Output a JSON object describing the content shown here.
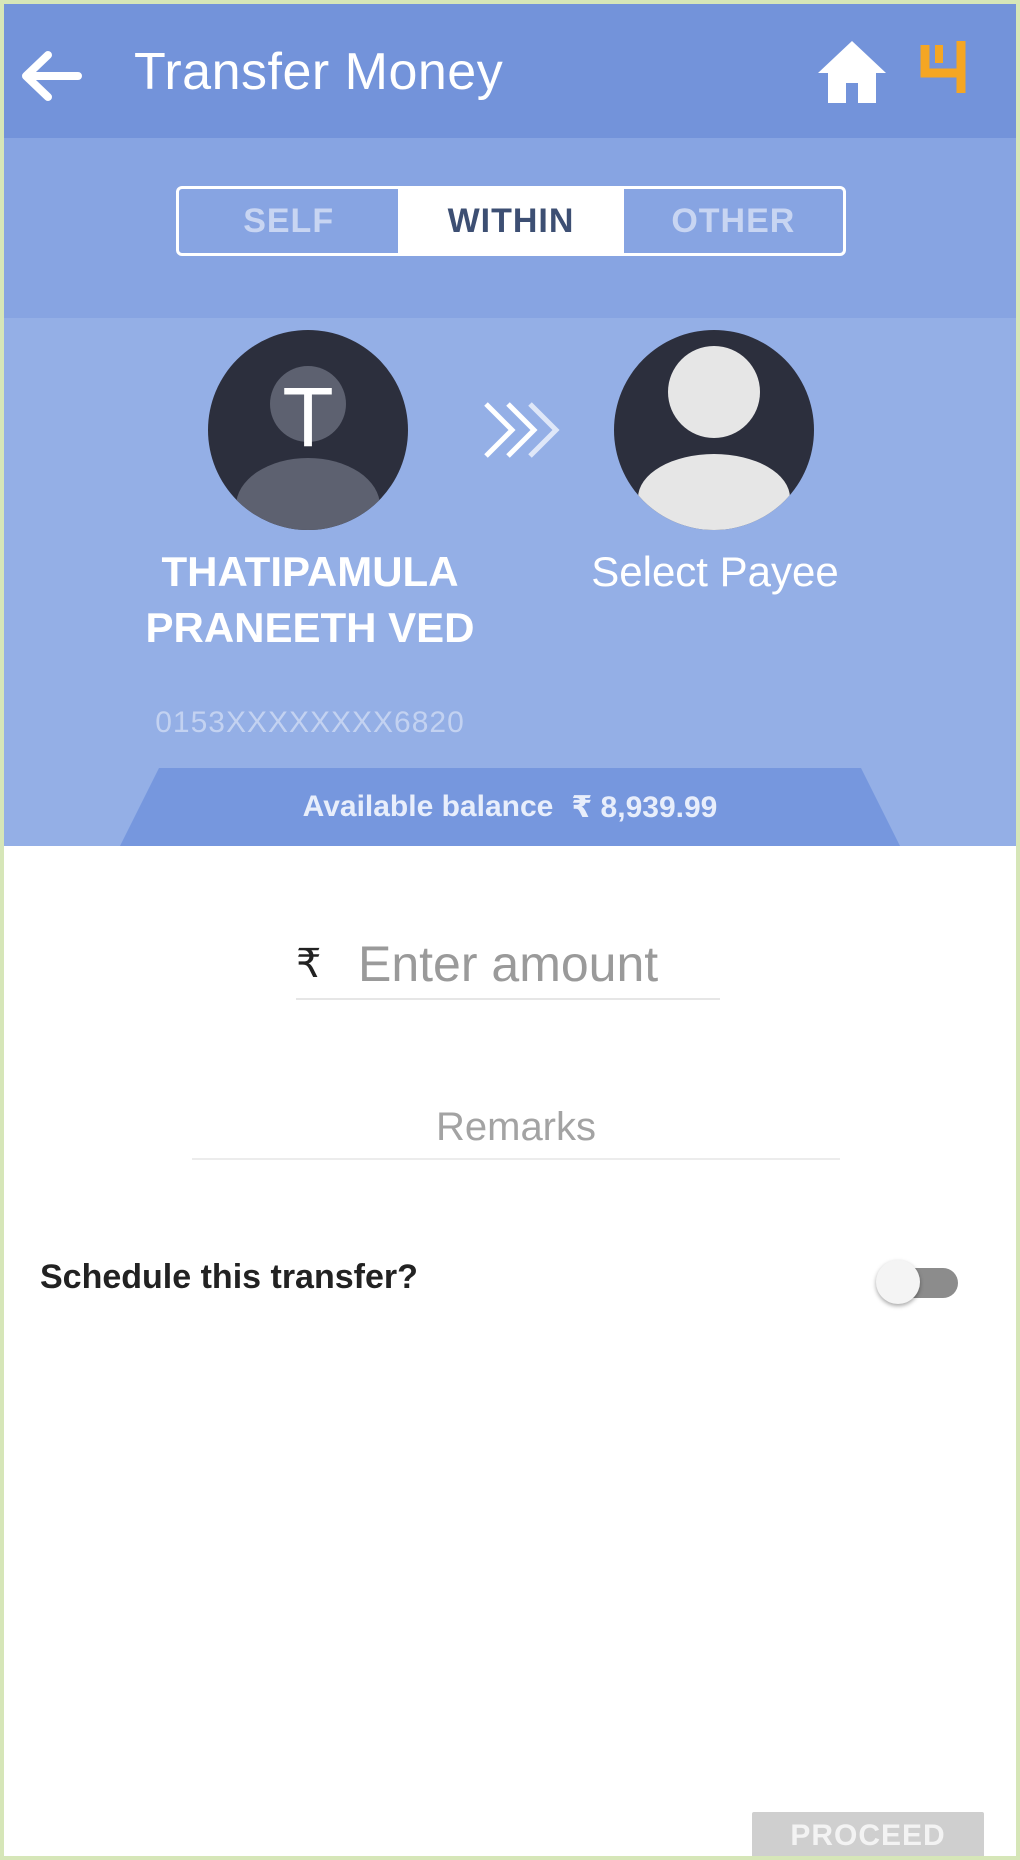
{
  "appbar": {
    "title": "Transfer Money",
    "back_icon": "back-arrow-icon",
    "home_icon": "home-icon",
    "logo_icon": "bank-logo-icon",
    "background_color": "#7393da",
    "logo_color": "#f5a623"
  },
  "transfer_type": {
    "options": [
      "SELF",
      "WITHIN",
      "OTHER"
    ],
    "selected": "WITHIN"
  },
  "from_account": {
    "initial": "T",
    "name": "THATIPAMULA PRANEETH VED",
    "account_number": "0153XXXXXXXX6820"
  },
  "to_account": {
    "label": "Select Payee",
    "avatar_icon": "person-icon"
  },
  "balance": {
    "label": "Available balance",
    "amount": "₹ 8,939.99"
  },
  "amount": {
    "currency_symbol": "₹",
    "placeholder": "Enter amount",
    "value": ""
  },
  "remarks": {
    "placeholder": "Remarks",
    "value": ""
  },
  "schedule": {
    "label": "Schedule this transfer?",
    "enabled": false
  },
  "proceed": {
    "label": "PROCEED"
  }
}
